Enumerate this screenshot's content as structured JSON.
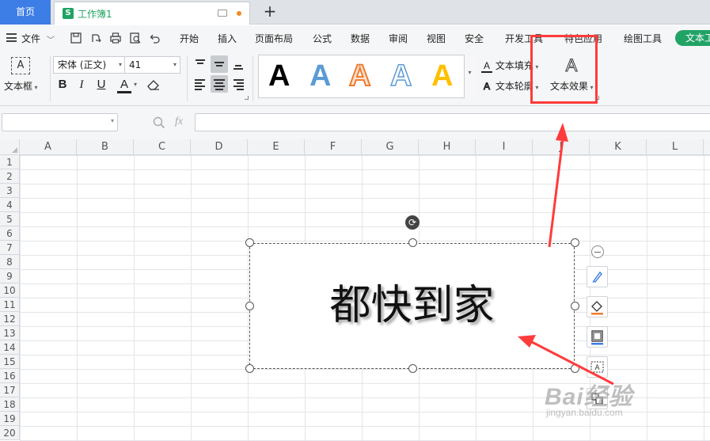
{
  "tabs": {
    "home_label": "首页",
    "doc_icon": "S",
    "doc_label": "工作簿1",
    "add_label": "+"
  },
  "menu": {
    "file_label": "文件",
    "file_caret": "﹀",
    "items": [
      "开始",
      "插入",
      "页面布局",
      "公式",
      "数据",
      "审阅",
      "视图",
      "安全",
      "开发工具",
      "特色应用",
      "绘图工具"
    ],
    "text_tool_label": "文本工具",
    "text_tool_color": "#21a366"
  },
  "ribbon": {
    "textbox_label": "文本框",
    "textbox_icon_text": "A",
    "font_name": "宋体 (正文)",
    "font_size": "41",
    "bold": "B",
    "italic": "I",
    "underline": "U",
    "font_color": "A",
    "text_fill_label": "文本填充",
    "text_outline_label": "文本轮廓",
    "text_effect_label": "文本效果",
    "gallery_glyph": "A",
    "gallery_colors": [
      "#000000",
      "#5b9bd5",
      "#ed7d31",
      "#5b9bd5",
      "#ffc000"
    ]
  },
  "formula": {
    "fx_label": "fx"
  },
  "sheet": {
    "columns": [
      "A",
      "B",
      "C",
      "D",
      "E",
      "F",
      "G",
      "H",
      "I",
      "J",
      "K",
      "L"
    ],
    "rows": [
      "1",
      "2",
      "3",
      "4",
      "5",
      "6",
      "7",
      "8",
      "9",
      "10",
      "11",
      "12",
      "13",
      "14",
      "15",
      "16",
      "17",
      "18",
      "19",
      "20"
    ],
    "textbox_content": "都快到家"
  },
  "watermark": {
    "brand": "Bai经验",
    "url": "jingyan.baidu.com"
  },
  "annotation_color": "#ff3b3b"
}
